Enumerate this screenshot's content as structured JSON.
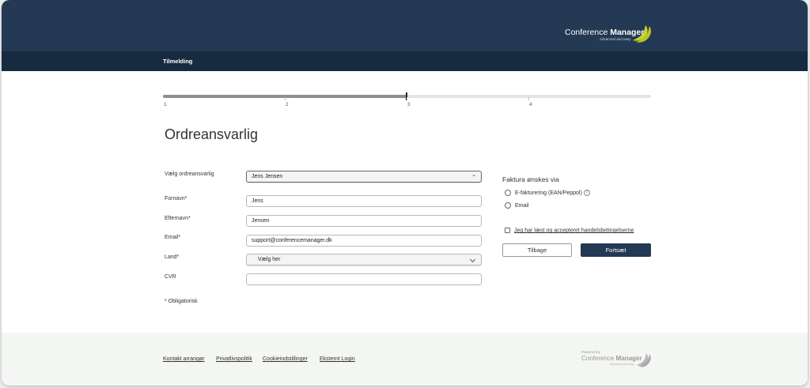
{
  "brand": {
    "logo_text_regular": "Conference",
    "logo_text_bold": "Manager",
    "logo_tagline": "Advanced and easy",
    "logo_icon": "banana-logo-icon"
  },
  "nav": {
    "item": "Tilmelding"
  },
  "progress": {
    "steps": [
      "1",
      "2",
      "3",
      "4"
    ],
    "current_step": 3,
    "fraction_complete": 0.5
  },
  "page": {
    "title": "Ordreansvarlig"
  },
  "form": {
    "responsible_label": "Vælg ordreansvarlig",
    "responsible_value": "Jens Jensen",
    "firstname_label": "Fornavn*",
    "firstname_value": "Jens",
    "lastname_label": "Efternavn*",
    "lastname_value": "Jensen",
    "email_label": "Email*",
    "email_value": "support@conferencemanager.dk",
    "country_label": "Land*",
    "country_value": "Vælg her",
    "cvr_label": "CVR",
    "cvr_value": "",
    "required_note": "* Obligatorisk"
  },
  "invoice": {
    "title": "Faktura ønskes via",
    "options": [
      "E-fakturering (EAN/Peppol)",
      "Email"
    ],
    "help_icon": "question-circle-icon",
    "terms_label": "Jeg har læst og accepteret handelsbetingelserne",
    "back_label": "Tilbage",
    "next_label": "Fortsæt"
  },
  "footer": {
    "links": [
      "Kontakt arrangør",
      "Privatlivspolitik",
      "Cookieindstillinger",
      "Eksternt Login"
    ],
    "powered_by": "Powered by",
    "powered_name_regular": "Conference",
    "powered_name_bold": "Manager",
    "powered_tagline": "Advanced and easy"
  },
  "colors": {
    "header": "#233954",
    "navbar": "#172b40",
    "primary_button": "#233954",
    "logo_accent": "#c8d42f",
    "footer_bg": "#f4f6f3"
  }
}
